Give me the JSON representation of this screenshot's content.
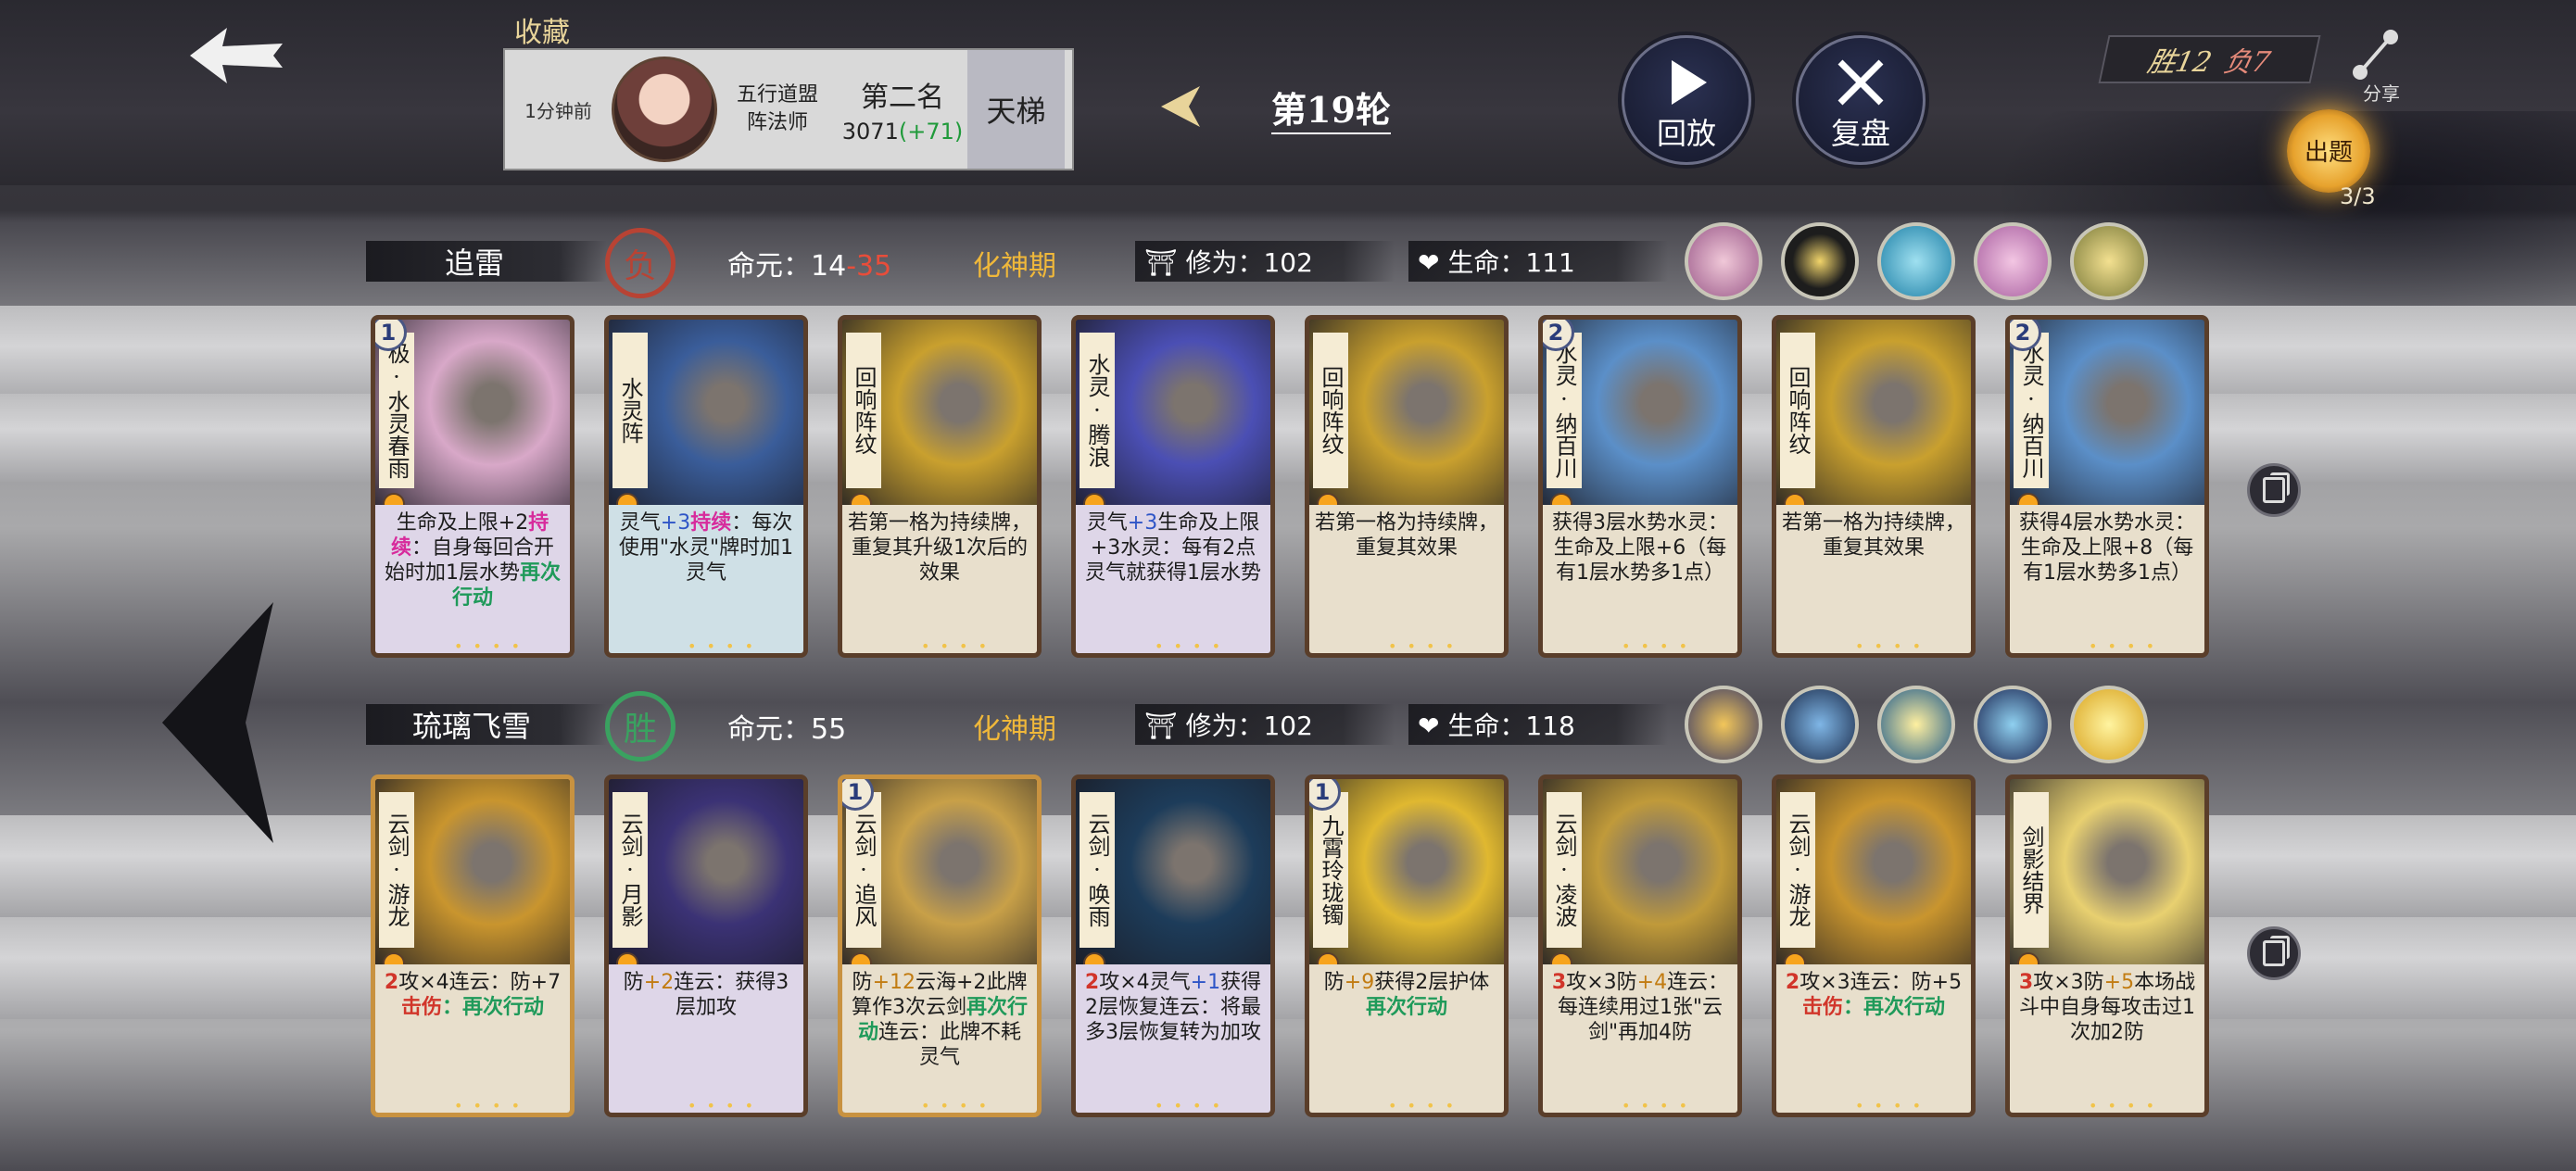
{
  "header": {
    "collection_label": "收藏",
    "opponent": {
      "time_ago": "1分钟前",
      "sect": "五行道盟",
      "role": "阵法师",
      "rank_label": "第二名",
      "score": "3071",
      "score_delta": "(+71)"
    },
    "ladder_label": "天梯",
    "round_label": "第19轮",
    "replay_label": "回放",
    "review_label": "复盘",
    "record": {
      "wins": "胜12",
      "losses": "负7"
    },
    "share_label": "分享",
    "lantern": {
      "label": "出题",
      "count": "3/3"
    }
  },
  "rows": [
    {
      "player_name": "追雷",
      "result": "负",
      "life_source_prefix": "命元：",
      "life_source_a": "14",
      "life_source_b": "-35",
      "stage": "化神期",
      "cultivation": "修为：102",
      "hp": "生命：111",
      "artifacts": [
        "pink-portrait-icon",
        "black-robe-figure-icon",
        "water-swirl-icon",
        "pink-flower-icon",
        "golden-shrine-icon"
      ],
      "cards": [
        {
          "cost": "1",
          "name": "极·水灵春雨",
          "desc": [
            {
              "t": "生命及上限+2"
            },
            {
              "t": "持续",
              "c": "pink"
            },
            {
              "t": "：自身每回合开始时加1层水势"
            },
            {
              "t": "再次行动",
              "c": "green"
            }
          ],
          "art": "#d8a8c8",
          "style": "pink"
        },
        {
          "cost": "",
          "name": "水灵阵",
          "desc": [
            {
              "t": "灵气"
            },
            {
              "t": "+3",
              "c": "blue"
            },
            {
              "t": "持续",
              "c": "pink"
            },
            {
              "t": "：每次使用\"水灵\"牌时加1灵气"
            }
          ],
          "art": "#3a5d9a",
          "style": "blue"
        },
        {
          "cost": "",
          "name": "回响阵纹",
          "desc": [
            {
              "t": "若第一格为持续牌，重复其升级1次后的效果"
            }
          ],
          "art": "#c9a02e",
          "style": ""
        },
        {
          "cost": "",
          "name": "水灵·腾浪",
          "desc": [
            {
              "t": "灵气"
            },
            {
              "t": "+3",
              "c": "blue"
            },
            {
              "t": "生命及上限+3"
            },
            {
              "t": "水灵：每有2点灵气就获得1层水势"
            }
          ],
          "art": "#4b4fb4",
          "style": "pink"
        },
        {
          "cost": "",
          "name": "回响阵纹",
          "desc": [
            {
              "t": "若第一格为持续牌，重复其效果"
            }
          ],
          "art": "#c9a02e",
          "style": ""
        },
        {
          "cost": "2",
          "name": "水灵·纳百川",
          "desc": [
            {
              "t": "获得3层水势"
            },
            {
              "t": "水灵：生命及上限+6（每有1层水势多1点）"
            }
          ],
          "art": "#5b8fc8",
          "style": ""
        },
        {
          "cost": "",
          "name": "回响阵纹",
          "desc": [
            {
              "t": "若第一格为持续牌，重复其效果"
            }
          ],
          "art": "#c9a02e",
          "style": ""
        },
        {
          "cost": "2",
          "name": "水灵·纳百川",
          "desc": [
            {
              "t": "获得4层水势"
            },
            {
              "t": "水灵：生命及上限+8（每有1层水势多1点）"
            }
          ],
          "art": "#5b8fc8",
          "style": ""
        }
      ]
    },
    {
      "player_name": "琉璃飞雪",
      "result": "胜",
      "life_source_prefix": "命元：",
      "life_source_a": "55",
      "life_source_b": "",
      "stage": "化神期",
      "cultivation": "修为：102",
      "hp": "生命：118",
      "artifacts": [
        "golden-dragon-icon",
        "blue-sword-icon",
        "golden-sun-icon",
        "blue-blade-icon",
        "sun-disc-icon"
      ],
      "cards": [
        {
          "cost": "",
          "name": "云剑·游龙",
          "desc": [
            {
              "t": "2",
              "c": "red"
            },
            {
              "t": "攻×4"
            },
            {
              "t": "连云：防+7"
            },
            {
              "t": "击伤",
              "c": "red"
            },
            {
              "t": "：再次行动",
              "c": "green"
            }
          ],
          "art": "#c9952e",
          "style": "",
          "gold": true
        },
        {
          "cost": "",
          "name": "云剑·月影",
          "desc": [
            {
              "t": "防"
            },
            {
              "t": "+2",
              "c": "gold"
            },
            {
              "t": "连云：获得3层加攻"
            }
          ],
          "art": "#3b3275",
          "style": "pink"
        },
        {
          "cost": "1",
          "name": "云剑·追风",
          "desc": [
            {
              "t": "防"
            },
            {
              "t": "+12",
              "c": "gold"
            },
            {
              "t": "云海+2"
            },
            {
              "t": "此牌算作3次云剑"
            },
            {
              "t": "再次行动",
              "c": "green"
            },
            {
              "t": "连云：此牌不耗灵气"
            }
          ],
          "art": "#c8a048",
          "style": "",
          "gold": true
        },
        {
          "cost": "",
          "name": "云剑·唤雨",
          "desc": [
            {
              "t": "2",
              "c": "red"
            },
            {
              "t": "攻×4"
            },
            {
              "t": "灵气"
            },
            {
              "t": "+1",
              "c": "blue"
            },
            {
              "t": "获得2层恢复"
            },
            {
              "t": "连云：将最多3层恢复转为加攻"
            }
          ],
          "art": "#1d3c5a",
          "style": "pink"
        },
        {
          "cost": "1",
          "name": "九霄玲珑镯",
          "desc": [
            {
              "t": "防"
            },
            {
              "t": "+9",
              "c": "gold"
            },
            {
              "t": "获得2层护体"
            },
            {
              "t": "再次行动",
              "c": "green"
            }
          ],
          "art": "#e0b830",
          "style": ""
        },
        {
          "cost": "",
          "name": "云剑·凌波",
          "desc": [
            {
              "t": "3",
              "c": "red"
            },
            {
              "t": "攻×3"
            },
            {
              "t": "防"
            },
            {
              "t": "+4",
              "c": "gold"
            },
            {
              "t": "连云：每连续用过1张\"云剑\"再加4防"
            }
          ],
          "art": "#c09a3a",
          "style": ""
        },
        {
          "cost": "",
          "name": "云剑·游龙",
          "desc": [
            {
              "t": "2",
              "c": "red"
            },
            {
              "t": "攻×3"
            },
            {
              "t": "连云：防+5"
            },
            {
              "t": "击伤",
              "c": "red"
            },
            {
              "t": "：再次行动",
              "c": "green"
            }
          ],
          "art": "#c9952e",
          "style": ""
        },
        {
          "cost": "",
          "name": "剑影结界",
          "desc": [
            {
              "t": "3",
              "c": "red"
            },
            {
              "t": "攻×3"
            },
            {
              "t": "防"
            },
            {
              "t": "+5",
              "c": "gold"
            },
            {
              "t": "本场战斗中自身每攻击过1次加2防"
            }
          ],
          "art": "#e8d070",
          "style": ""
        }
      ]
    }
  ],
  "colors": {
    "lose": "#b84334",
    "win": "#3aa260",
    "stage": "#f0b83a",
    "card_border": "#5a3e2a"
  }
}
